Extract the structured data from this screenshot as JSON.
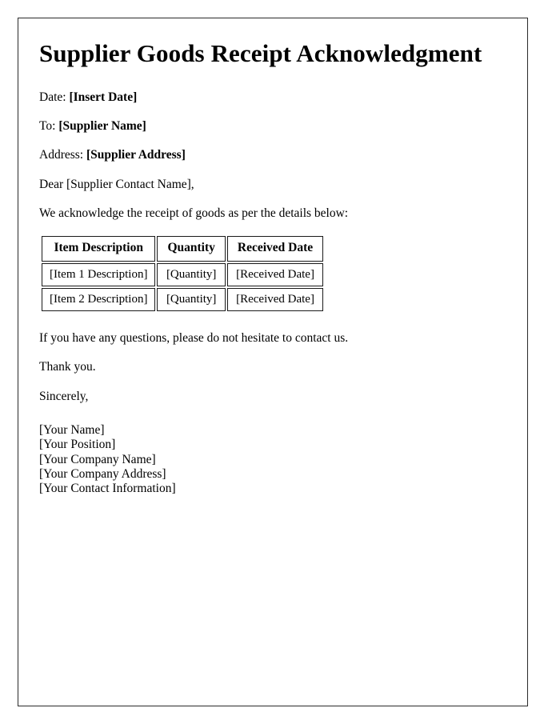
{
  "document": {
    "title": "Supplier Goods Receipt Acknowledgment",
    "fields": [
      {
        "label": "Date:",
        "value": "[Insert Date]"
      },
      {
        "label": "To:",
        "value": "[Supplier Name]"
      },
      {
        "label": "Address:",
        "value": "[Supplier Address]"
      }
    ],
    "salutation": "Dear [Supplier Contact Name],",
    "intro": "We acknowledge the receipt of goods as per the details below:",
    "table": {
      "headers": [
        "Item Description",
        "Quantity",
        "Received Date"
      ],
      "rows": [
        [
          "[Item 1 Description]",
          "[Quantity]",
          "[Received Date]"
        ],
        [
          "[Item 2 Description]",
          "[Quantity]",
          "[Received Date]"
        ]
      ]
    },
    "closing_questions": "If you have any questions, please do not hesitate to contact us.",
    "thanks": "Thank you.",
    "sign_off": "Sincerely,",
    "signature": [
      "[Your Name]",
      "[Your Position]",
      "[Your Company Name]",
      "[Your Company Address]",
      "[Your Contact Information]"
    ]
  }
}
